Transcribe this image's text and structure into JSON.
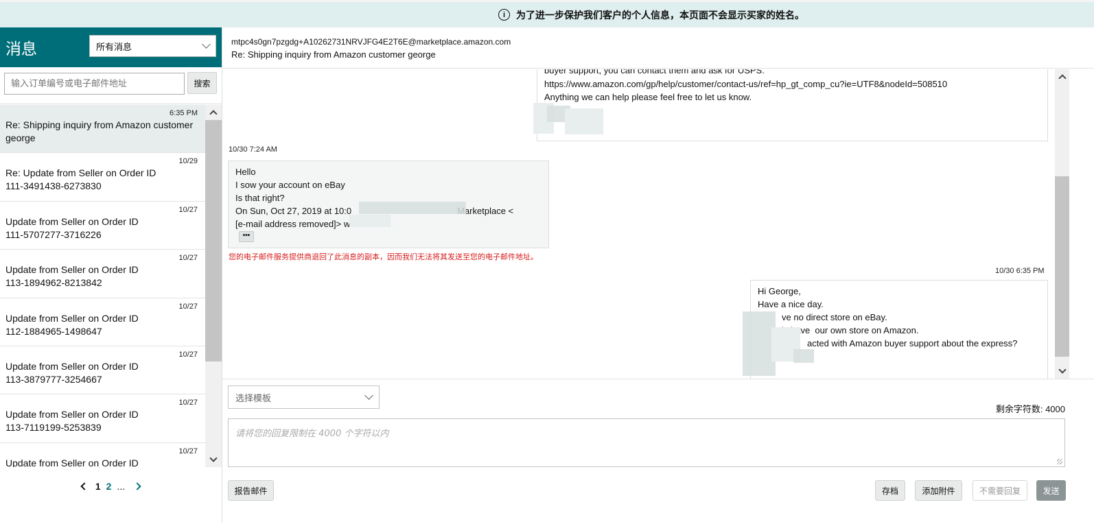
{
  "notice": {
    "text": "为了进一步保护我们客户的个人信息，本页面不会显示买家的姓名。"
  },
  "sidebar": {
    "title": "消息",
    "filter": {
      "selected": "所有消息"
    },
    "search": {
      "placeholder": "输入订单编号或电子邮件地址",
      "button": "搜索"
    },
    "messages": [
      {
        "date": "6:35 PM",
        "subject": "Re: Shipping inquiry from Amazon customer george",
        "order": ""
      },
      {
        "date": "10/29",
        "subject": "Re: Update from Seller on Order ID",
        "order": "111-3491438-6273830"
      },
      {
        "date": "10/27",
        "subject": "Update from Seller on Order ID",
        "order": "111-5707277-3716226"
      },
      {
        "date": "10/27",
        "subject": "Update from Seller on Order ID",
        "order": "113-1894962-8213842"
      },
      {
        "date": "10/27",
        "subject": "Update from Seller on Order ID",
        "order": "112-1884965-1498647"
      },
      {
        "date": "10/27",
        "subject": "Update from Seller on Order ID",
        "order": "113-3879777-3254667"
      },
      {
        "date": "10/27",
        "subject": "Update from Seller on Order ID",
        "order": "113-7119199-5253839"
      },
      {
        "date": "10/27",
        "subject": "Update from Seller on Order ID",
        "order": ""
      }
    ],
    "pager": {
      "current": "1",
      "next_page": "2",
      "ellipsis": "..."
    }
  },
  "conversation": {
    "email": "mtpc4s0gn7pzgdg+A10262731NRVJFG4E2T6E@marketplace.amazon.com",
    "subject": "Re: Shipping inquiry from Amazon customer george",
    "msg1_lines": [
      "buyer support, you can contact them and ask for USPS.",
      "https://www.amazon.com/gp/help/customer/contact-us/ref=hp_gt_comp_cu?ie=UTF8&nodeId=508510",
      "Anything we can help please feel free to let us know."
    ],
    "msg2": {
      "stamp": "10/30 7:24 AM",
      "lines": [
        "Hello",
        "I sow your account on eBay",
        "Is that right?",
        "On Sun, Oct 27, 2019 at 10:0",
        "[e-mail address removed]> wr"
      ],
      "line4_tail": "Marketplace <",
      "more": "•••",
      "bounce_notice": "您的电子邮件服务提供商退回了此消息的副本，因而我们无法将其发送至您的电子邮件地址。"
    },
    "msg3": {
      "stamp": "10/30 6:35 PM",
      "lines": [
        "Hi George,",
        "Have a nice day.",
        "ve no direct store on eBay.",
        "ly have  our own store on Amazon.",
        "acted with Amazon buyer support about the express?"
      ]
    }
  },
  "composer": {
    "template_placeholder": "选择模板",
    "char_count": "剩余字符数: 4000",
    "reply_placeholder": "请将您的回复限制在 4000 个字符以内",
    "buttons": {
      "report": "报告邮件",
      "archive": "存档",
      "attach": "添加附件",
      "no_reply": "不需要回复",
      "send": "发送"
    }
  }
}
